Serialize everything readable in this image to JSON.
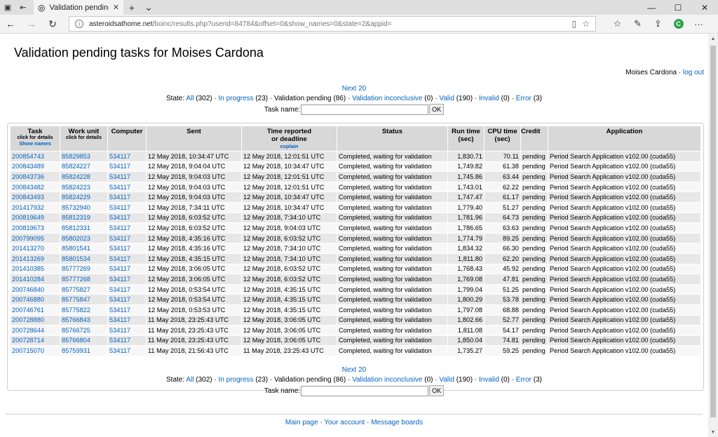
{
  "browser": {
    "tab_title": "Validation pending tasl",
    "url_domain": "asteroidsathome.net",
    "url_path": "/boinc/results.php?userid=84784&offset=0&show_names=0&state=2&appid="
  },
  "page": {
    "title": "Validation pending tasks for Moises Cardona",
    "user_name": "Moises Cardona",
    "logout": "log out"
  },
  "pager": {
    "next": "Next 20",
    "state_label": "State:",
    "states": [
      {
        "label": "All",
        "count": "(302)",
        "link": true
      },
      {
        "label": "In progress",
        "count": "(23)",
        "link": true
      },
      {
        "label": "Validation pending",
        "count": "(86)",
        "link": false
      },
      {
        "label": "Validation inconclusive",
        "count": "(0)",
        "link": true
      },
      {
        "label": "Valid",
        "count": "(190)",
        "link": true
      },
      {
        "label": "Invalid",
        "count": "(0)",
        "link": true
      },
      {
        "label": "Error",
        "count": "(3)",
        "link": true
      }
    ],
    "task_name_label": "Task name:",
    "ok": "OK"
  },
  "table": {
    "headers": {
      "task": "Task",
      "task_sub": "click for details",
      "show_names": "Show names",
      "workunit": "Work unit",
      "workunit_sub": "click for details",
      "computer": "Computer",
      "sent": "Sent",
      "reported_1": "Time reported",
      "reported_2": "or deadline",
      "explain": "explain",
      "status": "Status",
      "run_1": "Run time",
      "run_2": "(sec)",
      "cpu_1": "CPU time",
      "cpu_2": "(sec)",
      "credit": "Credit",
      "application": "Application"
    },
    "rows": [
      [
        "200854743",
        "85829853",
        "534117",
        "12 May 2018, 10:34:47 UTC",
        "12 May 2018, 12:01:51 UTC",
        "Completed, waiting for validation",
        "1,830.71",
        "70.11",
        "pending",
        "Period Search Application v102.00 (cuda55)"
      ],
      [
        "200843489",
        "85824227",
        "534117",
        "12 May 2018, 9:04:04 UTC",
        "12 May 2018, 10:34:47 UTC",
        "Completed, waiting for validation",
        "1,749.82",
        "61.38",
        "pending",
        "Period Search Application v102.00 (cuda55)"
      ],
      [
        "200843736",
        "85824228",
        "534117",
        "12 May 2018, 9:04:03 UTC",
        "12 May 2018, 12:01:51 UTC",
        "Completed, waiting for validation",
        "1,745.86",
        "63.44",
        "pending",
        "Period Search Application v102.00 (cuda55)"
      ],
      [
        "200843482",
        "85824223",
        "534117",
        "12 May 2018, 9:04:03 UTC",
        "12 May 2018, 12:01:51 UTC",
        "Completed, waiting for validation",
        "1,743.01",
        "62.22",
        "pending",
        "Period Search Application v102.00 (cuda55)"
      ],
      [
        "200843493",
        "85824229",
        "534117",
        "12 May 2018, 9:04:03 UTC",
        "12 May 2018, 10:34:47 UTC",
        "Completed, waiting for validation",
        "1,747.47",
        "61.17",
        "pending",
        "Period Search Application v102.00 (cuda55)"
      ],
      [
        "201417932",
        "85732940",
        "534117",
        "12 May 2018, 7:34:11 UTC",
        "12 May 2018, 10:34:47 UTC",
        "Completed, waiting for validation",
        "1,779.40",
        "51.27",
        "pending",
        "Period Search Application v102.00 (cuda55)"
      ],
      [
        "200819649",
        "85812319",
        "534117",
        "12 May 2018, 6:03:52 UTC",
        "12 May 2018, 7:34:10 UTC",
        "Completed, waiting for validation",
        "1,781.96",
        "64.73",
        "pending",
        "Period Search Application v102.00 (cuda55)"
      ],
      [
        "200819673",
        "85812331",
        "534117",
        "12 May 2018, 6:03:52 UTC",
        "12 May 2018, 9:04:03 UTC",
        "Completed, waiting for validation",
        "1,786.65",
        "63.63",
        "pending",
        "Period Search Application v102.00 (cuda55)"
      ],
      [
        "200799095",
        "85802023",
        "534117",
        "12 May 2018, 4:35:16 UTC",
        "12 May 2018, 6:03:52 UTC",
        "Completed, waiting for validation",
        "1,774.79",
        "89.25",
        "pending",
        "Period Search Application v102.00 (cuda55)"
      ],
      [
        "201413270",
        "85801541",
        "534117",
        "12 May 2018, 4:35:16 UTC",
        "12 May 2018, 7:34:10 UTC",
        "Completed, waiting for validation",
        "1,834.32",
        "66.30",
        "pending",
        "Period Search Application v102.00 (cuda55)"
      ],
      [
        "201413269",
        "85801534",
        "534117",
        "12 May 2018, 4:35:15 UTC",
        "12 May 2018, 7:34:10 UTC",
        "Completed, waiting for validation",
        "1,811.80",
        "62.20",
        "pending",
        "Period Search Application v102.00 (cuda55)"
      ],
      [
        "201410385",
        "85777269",
        "534117",
        "12 May 2018, 3:06:05 UTC",
        "12 May 2018, 6:03:52 UTC",
        "Completed, waiting for validation",
        "1,768.43",
        "45.92",
        "pending",
        "Period Search Application v102.00 (cuda55)"
      ],
      [
        "201410284",
        "85777268",
        "534117",
        "12 May 2018, 3:06:05 UTC",
        "12 May 2018, 6:03:52 UTC",
        "Completed, waiting for validation",
        "1,769.08",
        "47.81",
        "pending",
        "Period Search Application v102.00 (cuda55)"
      ],
      [
        "200746840",
        "85775827",
        "534117",
        "12 May 2018, 0:53:54 UTC",
        "12 May 2018, 4:35:15 UTC",
        "Completed, waiting for validation",
        "1,799.04",
        "51.25",
        "pending",
        "Period Search Application v102.00 (cuda55)"
      ],
      [
        "200746880",
        "85775847",
        "534117",
        "12 May 2018, 0:53:54 UTC",
        "12 May 2018, 4:35:15 UTC",
        "Completed, waiting for validation",
        "1,800.29",
        "53.78",
        "pending",
        "Period Search Application v102.00 (cuda55)"
      ],
      [
        "200746761",
        "85775822",
        "534117",
        "12 May 2018, 0:53:53 UTC",
        "12 May 2018, 4:35:15 UTC",
        "Completed, waiting for validation",
        "1,797.08",
        "68.88",
        "pending",
        "Period Search Application v102.00 (cuda55)"
      ],
      [
        "200728880",
        "85766843",
        "534117",
        "11 May 2018, 23:25:43 UTC",
        "12 May 2018, 3:06:05 UTC",
        "Completed, waiting for validation",
        "1,802.66",
        "52.77",
        "pending",
        "Period Search Application v102.00 (cuda55)"
      ],
      [
        "200728644",
        "85766725",
        "534117",
        "11 May 2018, 23:25:43 UTC",
        "12 May 2018, 3:06:05 UTC",
        "Completed, waiting for validation",
        "1,811.08",
        "54.17",
        "pending",
        "Period Search Application v102.00 (cuda55)"
      ],
      [
        "200728714",
        "85766804",
        "534117",
        "11 May 2018, 23:25:43 UTC",
        "12 May 2018, 3:06:05 UTC",
        "Completed, waiting for validation",
        "1,850.04",
        "74.81",
        "pending",
        "Period Search Application v102.00 (cuda55)"
      ],
      [
        "200715070",
        "85759931",
        "534117",
        "11 May 2018, 21:56:43 UTC",
        "11 May 2018, 23:25:43 UTC",
        "Completed, waiting for validation",
        "1,735.27",
        "59.25",
        "pending",
        "Period Search Application v102.00 (cuda55)"
      ]
    ]
  },
  "footer": {
    "links": [
      "Main page",
      "Your account",
      "Message boards"
    ]
  }
}
